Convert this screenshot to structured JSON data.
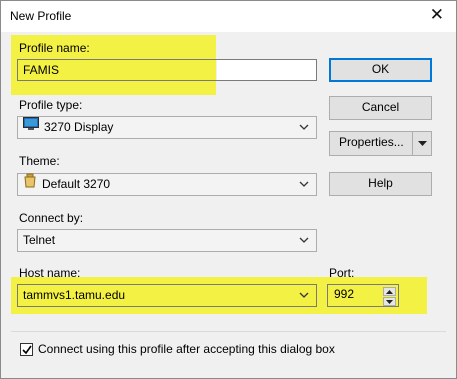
{
  "window": {
    "title": "New Profile",
    "close_glyph": "✕"
  },
  "profile_name": {
    "label": "Profile name:",
    "value": "FAMIS"
  },
  "profile_type": {
    "label": "Profile type:",
    "value": "3270 Display",
    "icon": "terminal-icon"
  },
  "theme": {
    "label": "Theme:",
    "value": "Default 3270",
    "icon": "theme-icon"
  },
  "connect_by": {
    "label": "Connect by:",
    "value": "Telnet"
  },
  "host_name": {
    "label": "Host name:",
    "value": "tammvs1.tamu.edu"
  },
  "port": {
    "label": "Port:",
    "value": "992"
  },
  "buttons": {
    "ok": "OK",
    "cancel": "Cancel",
    "properties": "Properties...",
    "help": "Help"
  },
  "connect_checkbox": {
    "label": "Connect using this profile after accepting this dialog box",
    "checked": true
  },
  "colors": {
    "highlight": "#f4f145",
    "accent": "#0078d7",
    "dialog_bg": "#f0f0f0"
  }
}
